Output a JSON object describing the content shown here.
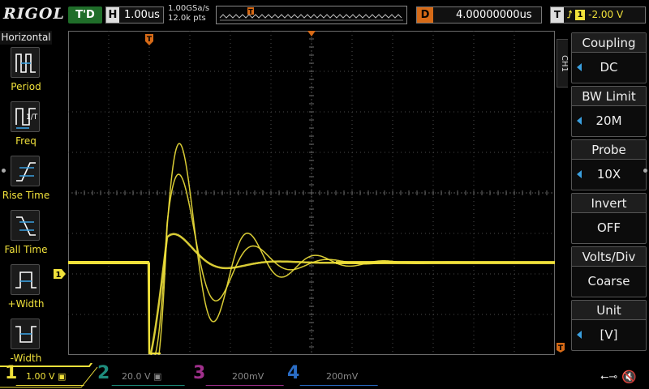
{
  "brand": "RIGOL",
  "status": "T'D",
  "horizontal": {
    "label": "H",
    "scale": "1.00us"
  },
  "acquire": {
    "sample_rate": "1.00GSa/s",
    "points": "12.0k pts"
  },
  "delay": {
    "label": "D",
    "value": "4.00000000us"
  },
  "trigger": {
    "label": "T",
    "edge": "rising-edge-icon",
    "source": "1",
    "level": "-2.00 V"
  },
  "left_menu": {
    "title": "Horizontal",
    "items": [
      {
        "label": "Period",
        "icon": "period-icon"
      },
      {
        "label": "Freq",
        "icon": "frequency-icon"
      },
      {
        "label": "Rise Time",
        "icon": "rise-time-icon"
      },
      {
        "label": "Fall Time",
        "icon": "fall-time-icon"
      },
      {
        "label": "+Width",
        "icon": "positive-width-icon"
      },
      {
        "label": "-Width",
        "icon": "negative-width-icon"
      }
    ]
  },
  "channel_tab": "CH1",
  "right_menu": [
    {
      "title": "Coupling",
      "value": "DC",
      "arrow": true
    },
    {
      "title": "BW Limit",
      "value": "20M",
      "arrow": true
    },
    {
      "title": "Probe",
      "value": "10X",
      "arrow": true
    },
    {
      "title": "Invert",
      "value": "OFF",
      "arrow": false
    },
    {
      "title": "Volts/Div",
      "value": "Coarse",
      "arrow": false
    },
    {
      "title": "Unit",
      "value": "[V]",
      "arrow": true
    }
  ],
  "channels": [
    {
      "num": "1",
      "scale": "1.00 V",
      "color": "#f0e13b",
      "active": true
    },
    {
      "num": "2",
      "scale": "20.0 V",
      "color": "#1e8c7c",
      "active": false
    },
    {
      "num": "3",
      "scale": "200mV",
      "color": "#a0308c",
      "active": false
    },
    {
      "num": "4",
      "scale": "200mV",
      "color": "#2a6cc4",
      "active": false
    }
  ],
  "ch1_marker": "1",
  "trigger_marker": "T",
  "colors": {
    "ch1": "#f0e13b",
    "trigger": "#d66a17",
    "grid": "#4a4a4a",
    "status": "#1f6d29",
    "arrow": "#3aa0e0"
  }
}
